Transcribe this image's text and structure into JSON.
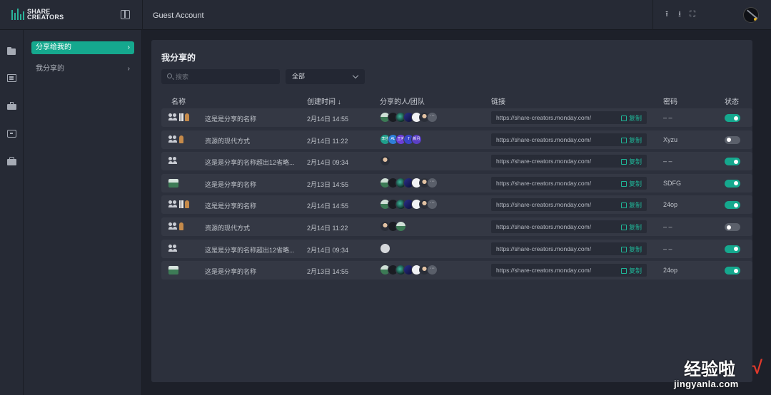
{
  "brand": {
    "logo_line1": "SHARE",
    "logo_line2": "CREATORS"
  },
  "header": {
    "account": "Guest Account"
  },
  "sidebar": {
    "items": [
      {
        "label": "分享给我的",
        "active": true
      },
      {
        "label": "我分享的",
        "active": false
      }
    ]
  },
  "main": {
    "title": "我分享的",
    "search": {
      "placeholder": "搜索",
      "value": ""
    },
    "filter": {
      "selected": "全部"
    },
    "columns": {
      "name": "名称",
      "created": "创建时间",
      "sort_arrow": "↓",
      "shared_with": "分享的人/团队",
      "link": "链接",
      "password": "密码",
      "status": "状态"
    },
    "copy_label": "复制",
    "rows": [
      {
        "owner_icons": [
          "people-icon",
          "bars-icon",
          "figure-icon"
        ],
        "name": "这是是分享的名称",
        "created": "2月14日 14:55",
        "avatars": [
          "landscape",
          "dark",
          "green",
          "purple",
          "white",
          "photo"
        ],
        "more": "···",
        "link": "https://share-creators.monday.com/",
        "password": "– –",
        "enabled": true
      },
      {
        "owner_icons": [
          "people-icon",
          "figure-icon"
        ],
        "name": "资源的现代方式",
        "created": "2月14日 11:22",
        "avatars": [
          "李佳",
          "AL",
          "王冲",
          "T",
          "新月"
        ],
        "more": "",
        "link": "https://share-creators.monday.com/",
        "password": "Xyzu",
        "enabled": false
      },
      {
        "owner_icons": [
          "people-icon"
        ],
        "name": "这是是分享的名称超出12省略...",
        "created": "2月14日 09:34",
        "avatars": [
          "photo"
        ],
        "more": "",
        "link": "https://share-creators.monday.com/",
        "password": "– –",
        "enabled": true
      },
      {
        "owner_icons": [
          "thumb-icon"
        ],
        "name": "这是是分享的名称",
        "created": "2月13日 14:55",
        "avatars": [
          "landscape",
          "dark",
          "green",
          "purple",
          "white",
          "photo"
        ],
        "more": "···",
        "link": "https://share-creators.monday.com/",
        "password": "SDFG",
        "enabled": true
      },
      {
        "owner_icons": [
          "people-icon",
          "bars-icon",
          "figure-icon"
        ],
        "name": "这是是分享的名称",
        "created": "2月14日 14:55",
        "avatars": [
          "landscape",
          "dark",
          "green",
          "purple",
          "white",
          "photo"
        ],
        "more": "···",
        "link": "https://share-creators.monday.com/",
        "password": "24op",
        "enabled": true
      },
      {
        "owner_icons": [
          "people-icon",
          "figure-icon"
        ],
        "name": "资源的现代方式",
        "created": "2月14日 11:22",
        "avatars": [
          "photo",
          "dark",
          "landscape"
        ],
        "more": "",
        "link": "https://share-creators.monday.com/",
        "password": "– –",
        "enabled": false
      },
      {
        "owner_icons": [
          "people-icon"
        ],
        "name": "这是是分享的名称超出12省略...",
        "created": "2月14日 09:34",
        "avatars": [
          "github"
        ],
        "more": "",
        "link": "https://share-creators.monday.com/",
        "password": "– –",
        "enabled": true
      },
      {
        "owner_icons": [
          "thumb-icon"
        ],
        "name": "这是是分享的名称",
        "created": "2月13日 14:55",
        "avatars": [
          "landscape",
          "dark",
          "green",
          "purple",
          "white",
          "photo"
        ],
        "more": "···",
        "link": "https://share-creators.monday.com/",
        "password": "24op",
        "enabled": true
      }
    ]
  },
  "watermark": {
    "text": "经验啦",
    "url": "jingyanla.com"
  },
  "colors": {
    "accent": "#15a88e",
    "background": "#1d2029",
    "card": "#2c303c",
    "row": "#343844"
  }
}
